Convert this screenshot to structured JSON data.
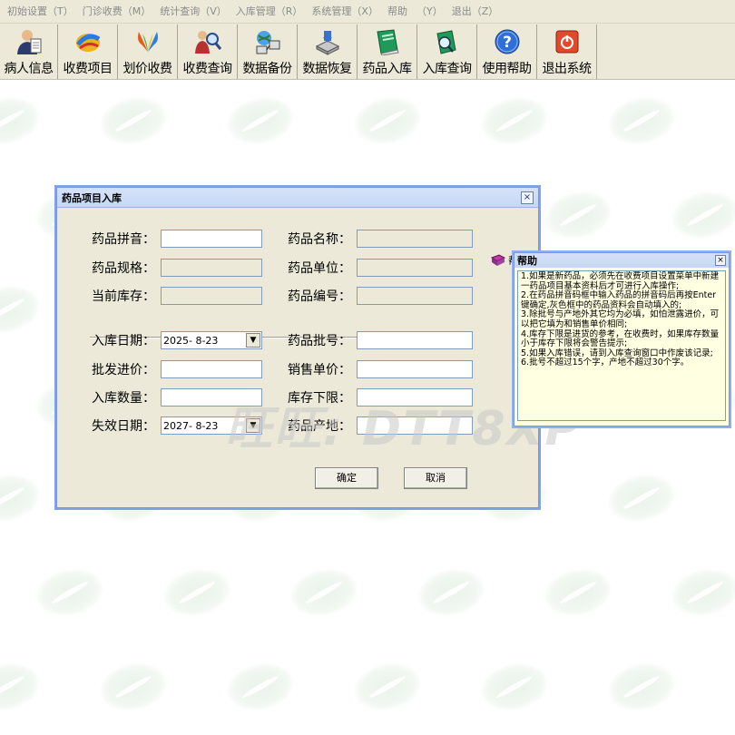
{
  "menubar": {
    "items": [
      "初始设置（T）",
      "门诊收费（M）",
      "统计查询（V）",
      "入库管理（R）",
      "系统管理（X）",
      "帮助",
      "（Y）",
      "退出（Z）"
    ]
  },
  "toolbar": {
    "buttons": [
      "病人信息",
      "收费项目",
      "划价收费",
      "收费查询",
      "数据备份",
      "数据恢复",
      "药品入库",
      "入库查询",
      "使用帮助",
      "退出系统"
    ]
  },
  "dialog": {
    "title": "药品项目入库",
    "close": "×",
    "help_label": "帮助",
    "labels": {
      "pinyin": "药品拼音：",
      "name": "药品名称：",
      "spec": "药品规格：",
      "unit": "药品单位：",
      "stock": "当前库存：",
      "code": "药品编号：",
      "in_date": "入库日期：",
      "batch": "药品批号：",
      "wholesale": "批发进价：",
      "retail": "销售单价：",
      "qty": "入库数量：",
      "min_stock": "库存下限：",
      "expire": "失效日期：",
      "origin": "药品产地："
    },
    "in_date_value": "2025- 8-23",
    "expire_value": "2027- 8-23",
    "ok": "确定",
    "cancel": "取消"
  },
  "watermark": "旺旺: DTT8XP",
  "help_popup": {
    "title": "帮助",
    "close": "×",
    "lines": [
      "1.如果是新药品，必须先在收费项目设置菜单中新建一药品项目基本资料后才可进行入库操作;",
      "2.在药品拼音码框中输入药品的拼音码后再按Enter键确定,灰色框中的药品资料会自动填入的;",
      "3.除批号与产地外其它均为必填，如怕泄露进价，可以把它填为和销售单价相同;",
      "4.库存下限是进货的参考，在收费时，如果库存数量小于库存下限将会警告提示;",
      "5.如果入库错误，请到入库查询窗口中作废该记录;",
      "6.批号不超过15个字，产地不超过30个字。"
    ]
  },
  "colors": {
    "window_face": "#ece9d8",
    "title_blue": "#c7d8f5",
    "tooltip_bg": "#ffffe1"
  }
}
